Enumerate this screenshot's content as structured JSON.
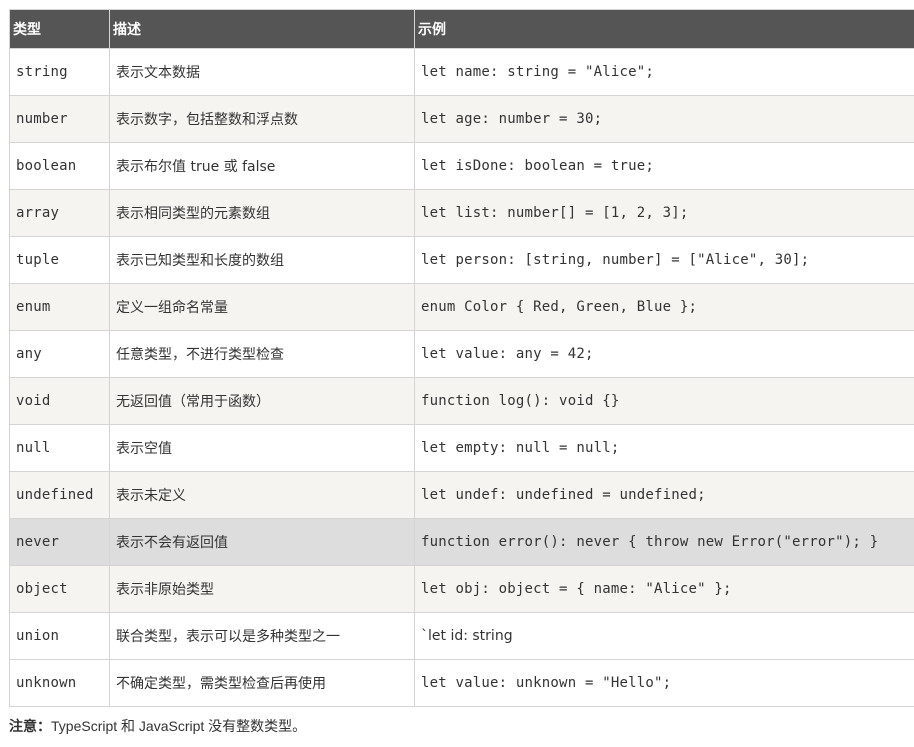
{
  "table": {
    "headers": [
      "类型",
      "描述",
      "示例"
    ],
    "rows": [
      {
        "type": "string",
        "description": "表示文本数据",
        "example": "let name: string = \"Alice\";"
      },
      {
        "type": "number",
        "description": "表示数字，包括整数和浮点数",
        "example": "let age: number = 30;"
      },
      {
        "type": "boolean",
        "description": "表示布尔值 true 或 false",
        "example": "let isDone: boolean = true;"
      },
      {
        "type": "array",
        "description": "表示相同类型的元素数组",
        "example": "let list: number[] = [1, 2, 3];"
      },
      {
        "type": "tuple",
        "description": "表示已知类型和长度的数组",
        "example": "let person: [string, number] = [\"Alice\", 30];"
      },
      {
        "type": "enum",
        "description": "定义一组命名常量",
        "example": "enum Color { Red, Green, Blue };"
      },
      {
        "type": "any",
        "description": "任意类型，不进行类型检查",
        "example": "let value: any = 42;"
      },
      {
        "type": "void",
        "description": "无返回值（常用于函数）",
        "example": "function log(): void {}"
      },
      {
        "type": "null",
        "description": "表示空值",
        "example": "let empty: null = null;"
      },
      {
        "type": "undefined",
        "description": "表示未定义",
        "example": "let undef: undefined = undefined;"
      },
      {
        "type": "never",
        "description": "表示不会有返回值",
        "example": "function error(): never { throw new Error(\"error\"); }"
      },
      {
        "type": "object",
        "description": "表示非原始类型",
        "example": "let obj: object = { name: \"Alice\" };"
      },
      {
        "type": "union",
        "description": "联合类型，表示可以是多种类型之一",
        "example": "`let id: string"
      },
      {
        "type": "unknown",
        "description": "不确定类型，需类型检查后再使用",
        "example": "let value: unknown = \"Hello\";"
      }
    ]
  },
  "note": {
    "label": "注意：",
    "text": "TypeScript 和 JavaScript 没有整数类型。"
  }
}
